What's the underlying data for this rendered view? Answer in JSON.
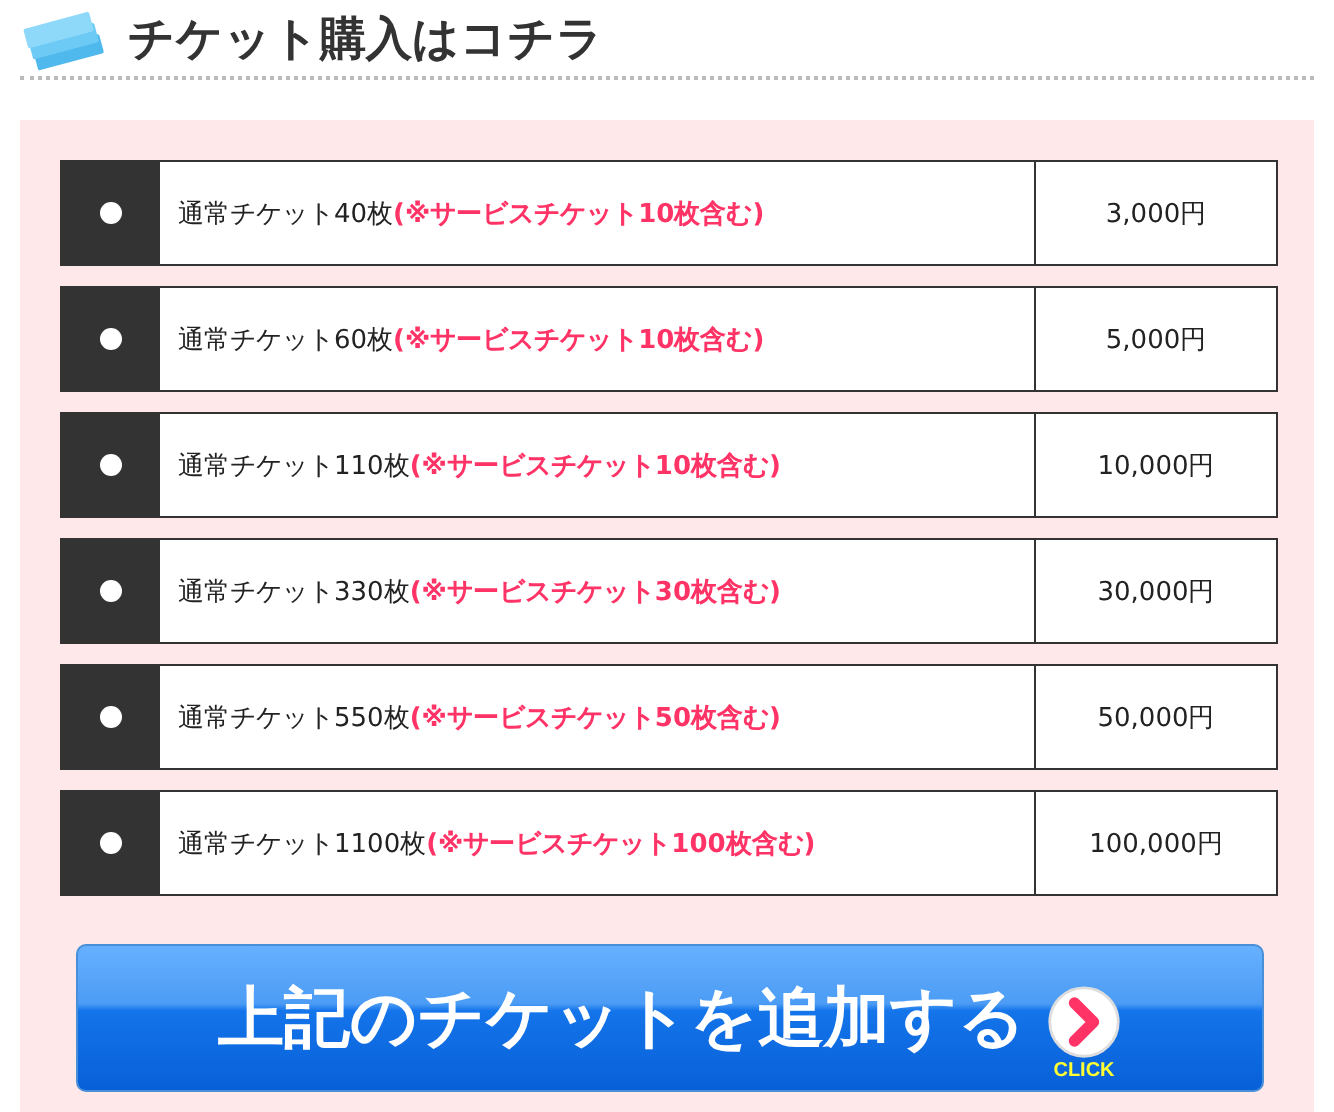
{
  "heading": {
    "title": "チケット購入はコチラ"
  },
  "options": [
    {
      "label": "通常チケット40枚**(※サービスチケット10枚含む)**",
      "price": "3,000円",
      "selected": false
    },
    {
      "label": "通常チケット60枚**(※サービスチケット10枚含む)**",
      "price": "5,000円",
      "selected": false
    },
    {
      "label": "通常チケット110枚**(※サービスチケット10枚含む)**",
      "price": "10,000円",
      "selected": false
    },
    {
      "label": "通常チケット330枚**(※サービスチケット30枚含む)**",
      "price": "30,000円",
      "selected": false
    },
    {
      "label": "通常チケット550枚**(※サービスチケット50枚含む)**",
      "price": "50,000円",
      "selected": false
    },
    {
      "label": "通常チケット1100枚**(※サービスチケット100枚含む)**",
      "price": "100,000円",
      "selected": false
    }
  ],
  "add_button": {
    "label": "上記のチケットを追加する",
    "hint": "CLICK"
  }
}
